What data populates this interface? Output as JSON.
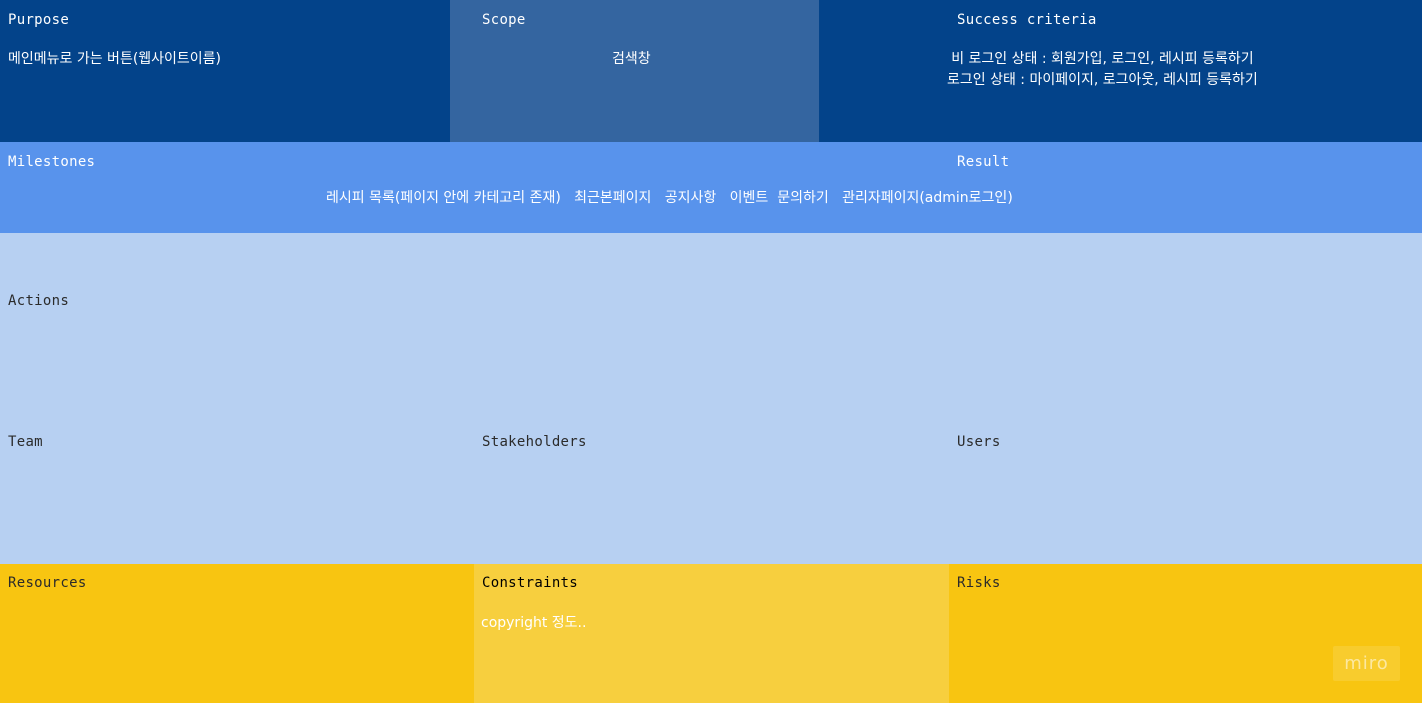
{
  "board": {
    "purpose": {
      "label": "Purpose",
      "text": "메인메뉴로 가는 버튼(웹사이트이름)"
    },
    "scope": {
      "label": "Scope",
      "text": "검색창"
    },
    "success_criteria": {
      "label": "Success criteria",
      "lines": [
        "비 로그인 상태 :  회원가입, 로그인, 레시피 등록하기",
        "로그인 상태 : 마이페이지, 로그아웃, 레시피 등록하기"
      ]
    },
    "milestones": {
      "label": "Milestones",
      "text": "레시피 목록(페이지 안에 카테고리 존재)   최근본페이지   공지사항   이벤트  문의하기   관리자페이지(admin로그인)"
    },
    "result": {
      "label": "Result"
    },
    "actions": {
      "label": "Actions"
    },
    "team": {
      "label": "Team"
    },
    "stakeholders": {
      "label": "Stakeholders"
    },
    "users": {
      "label": "Users"
    },
    "resources": {
      "label": "Resources"
    },
    "constraints": {
      "label": "Constraints",
      "text": "copyright 정도.."
    },
    "risks": {
      "label": "Risks"
    }
  },
  "watermark": "miro",
  "colors": {
    "dark_blue": "#03438a",
    "scope_blue": "#3465a0",
    "mid_blue": "#5893ec",
    "light_blue": "#b7d0f2",
    "yellow": "#f8c511",
    "light_yellow": "#f7cf3e"
  }
}
